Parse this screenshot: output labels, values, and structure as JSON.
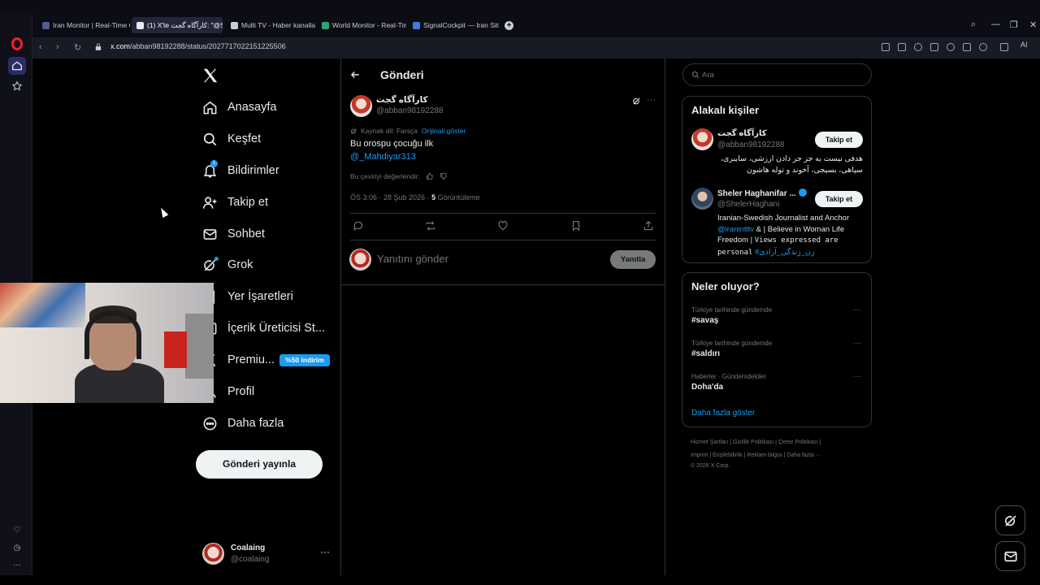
{
  "browser": {
    "tabs": [
      {
        "title": "Iran Monitor | Real-Time C",
        "color": "#4e5c9a"
      },
      {
        "title": "(1) X'te کارآگاه گجت: \"@Sh",
        "color": "#e7e9ea"
      },
      {
        "title": "Multi TV - Haber kanalları",
        "color": "#c9cbd6"
      },
      {
        "title": "World Monitor - Real-Tim",
        "color": "#2aa37a"
      },
      {
        "title": "SignalCockpit — Iran Situ",
        "color": "#3f7be0"
      }
    ],
    "url_host": "x.com",
    "url_path": "/abban98192288/status/2027717022151225506",
    "ai_label": "AI"
  },
  "nav": {
    "items": [
      {
        "label": "Anasayfa"
      },
      {
        "label": "Keşfet"
      },
      {
        "label": "Bildirimler"
      },
      {
        "label": "Takip et"
      },
      {
        "label": "Sohbet"
      },
      {
        "label": "Grok"
      },
      {
        "label": "Yer İşaretleri"
      },
      {
        "label": "İçerik Üreticisi St..."
      },
      {
        "label": "Premiu..."
      },
      {
        "label": "Profil"
      },
      {
        "label": "Daha fazla"
      }
    ],
    "notif_count": "1",
    "premium_badge": "%50 indirim",
    "post_button": "Gönderi yayınla",
    "account_name": "Coalaing",
    "account_handle": "@coalaing"
  },
  "post": {
    "header": "Gönderi",
    "author_name": "کارآگاه گجت",
    "author_handle": "@abban98192288",
    "source_lang": "Kaynak dil: Farsça",
    "show_original": "Orijinali göster",
    "text": "Bu orospu çocuğu ilk",
    "mention": "@_Mahdiyar313",
    "rate_translation": "Bu çeviriyi değerlendir:",
    "timestamp": "ÖS 3:06 · 28 Şub 2026 · ",
    "views_count": "5",
    "views_label": " Görüntüleme",
    "reply_placeholder": "Yanıtını gönder",
    "reply_button": "Yanıtla"
  },
  "right": {
    "search_placeholder": "Ara",
    "related_title": "Alakalı kişiler",
    "people": [
      {
        "name": "کارآگاه گجت",
        "handle": "@abban98192288",
        "follow": "Takip et",
        "bio": "هدفی نیست به جز جر دادن ارزشی، سایبری، سپاهی، بسیجی، آخوند و توله هاشون"
      },
      {
        "name": "Sheler Haghanifar ...",
        "handle": "@ShelerHaghani",
        "follow": "Takip et",
        "bio_line1": "Iranian-Swedish Journalist and Anchor",
        "bio_link1": "@iranintltv",
        "bio_line2": " & | Believe in Woman Life",
        "bio_line3": "Freedom | ",
        "bio_mono1": "Views expressed are",
        "bio_mono2": "personal",
        "bio_hashtag": " #زن_زندگی_آزادی"
      }
    ],
    "trends_title": "Neler oluyor?",
    "trends": [
      {
        "context": "Türkiye tarihinde gündemde",
        "name": "#savaş"
      },
      {
        "context": "Türkiye tarihinde gündemde",
        "name": "#saldırı"
      },
      {
        "context": "Haberler · Gündemdekiler",
        "name": "Doha'da"
      }
    ],
    "show_more": "Daha fazla göster",
    "footer_line1": "Hizmet Şartları  |   Gizlilik Politikası  |   Çerez Politikası  |",
    "footer_line2": "Imprint  |   Erişilebilirlik  |   Reklam bilgisi  |   Daha fazla ···",
    "footer_line3": "© 2026 X Corp."
  }
}
